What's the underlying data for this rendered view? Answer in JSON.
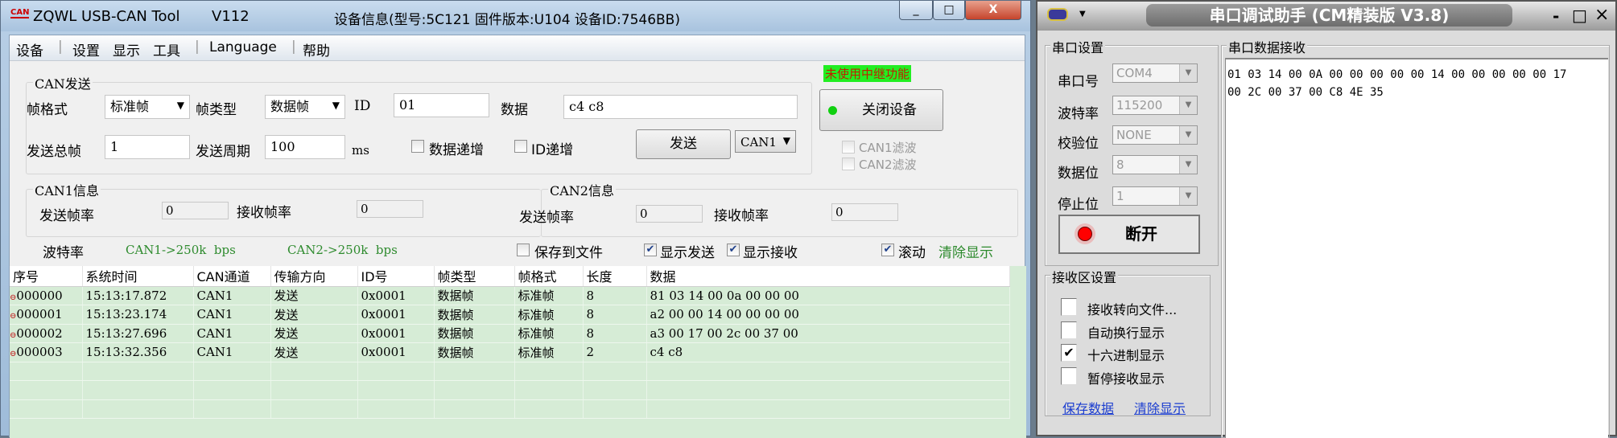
{
  "can_tool": {
    "title": "ZQWL USB-CAN Tool",
    "version": "V112",
    "device_info": "设备信息(型号:5C121   固件版本:U104   设备ID:7546BB)",
    "logo_text": "CAN",
    "window_buttons": {
      "minimize": "_",
      "maximize": "□",
      "close": "X"
    },
    "menu": [
      "设备",
      "设置",
      "显示",
      "工具",
      "Language",
      "帮助"
    ],
    "relay_status": "未使用中继功能",
    "close_device_label": "关闭设备",
    "filters": [
      "CAN1滤波",
      "CAN2滤波"
    ],
    "send_group": {
      "title": "CAN发送",
      "frame_format_label": "帧格式",
      "frame_format": "标准帧",
      "frame_type_label": "帧类型",
      "frame_type": "数据帧",
      "id_label": "ID",
      "id_value": "01",
      "data_label": "数据",
      "data_value": "c4 c8",
      "total_label": "发送总帧",
      "total_value": "1",
      "period_label": "发送周期",
      "period_value": "100",
      "period_unit": "ms",
      "data_inc_label": "数据递增",
      "id_inc_label": "ID递增",
      "send_label": "发送",
      "channel": "CAN1"
    },
    "can1_info": {
      "title": "CAN1信息",
      "send_rate_label": "发送帧率",
      "send_rate": "0",
      "recv_rate_label": "接收帧率",
      "recv_rate": "0"
    },
    "can2_info": {
      "title": "CAN2信息",
      "send_rate_label": "发送帧率",
      "send_rate": "0",
      "recv_rate_label": "接收帧率",
      "recv_rate": "0"
    },
    "baud": {
      "label": "波特率",
      "can1": "CAN1->250k  bps",
      "can2": "CAN2->250k  bps"
    },
    "options": {
      "save_file": "保存到文件",
      "show_send": "显示发送",
      "show_recv": "显示接收",
      "scroll": "滚动",
      "clear": "清除显示"
    },
    "table": {
      "headers": [
        "序号",
        "系统时间",
        "CAN通道",
        "传输方向",
        "ID号",
        "帧类型",
        "帧格式",
        "长度",
        "数据"
      ],
      "rows": [
        [
          "000000",
          "15:13:17.872",
          "CAN1",
          "发送",
          "0x0001",
          "数据帧",
          "标准帧",
          "8",
          "81 03 14 00 0a 00 00 00"
        ],
        [
          "000001",
          "15:13:23.174",
          "CAN1",
          "发送",
          "0x0001",
          "数据帧",
          "标准帧",
          "8",
          "a2 00 00 14 00 00 00 00"
        ],
        [
          "000002",
          "15:13:27.696",
          "CAN1",
          "发送",
          "0x0001",
          "数据帧",
          "标准帧",
          "8",
          "a3 00 17 00 2c 00 37 00"
        ],
        [
          "000003",
          "15:13:32.356",
          "CAN1",
          "发送",
          "0x0001",
          "数据帧",
          "标准帧",
          "2",
          "c4 c8"
        ]
      ]
    }
  },
  "serial_tool": {
    "title": "串口调试助手 (CM精装版 V3.8)",
    "window_buttons": {
      "minimize": "-",
      "maximize": "□",
      "close": "×"
    },
    "port_group": "串口设置",
    "fields": [
      {
        "label": "串口号",
        "value": "COM4"
      },
      {
        "label": "波特率",
        "value": "115200"
      },
      {
        "label": "校验位",
        "value": "NONE"
      },
      {
        "label": "数据位",
        "value": "8"
      },
      {
        "label": "停止位",
        "value": "1"
      }
    ],
    "disconnect_label": "断开",
    "recv_group": "接收区设置",
    "recv_options": [
      {
        "label": "接收转向文件...",
        "checked": false
      },
      {
        "label": "自动换行显示",
        "checked": false
      },
      {
        "label": "十六进制显示",
        "checked": true
      },
      {
        "label": "暂停接收显示",
        "checked": false
      }
    ],
    "save_link": "保存数据",
    "clear_link": "清除显示",
    "recv_title": "串口数据接收",
    "recv_lines": [
      "01 03 14 00 0A 00 00 00 00 00 14 00 00 00 00 00 17",
      "00 2C 00 37 00 C8 4E 35"
    ]
  }
}
